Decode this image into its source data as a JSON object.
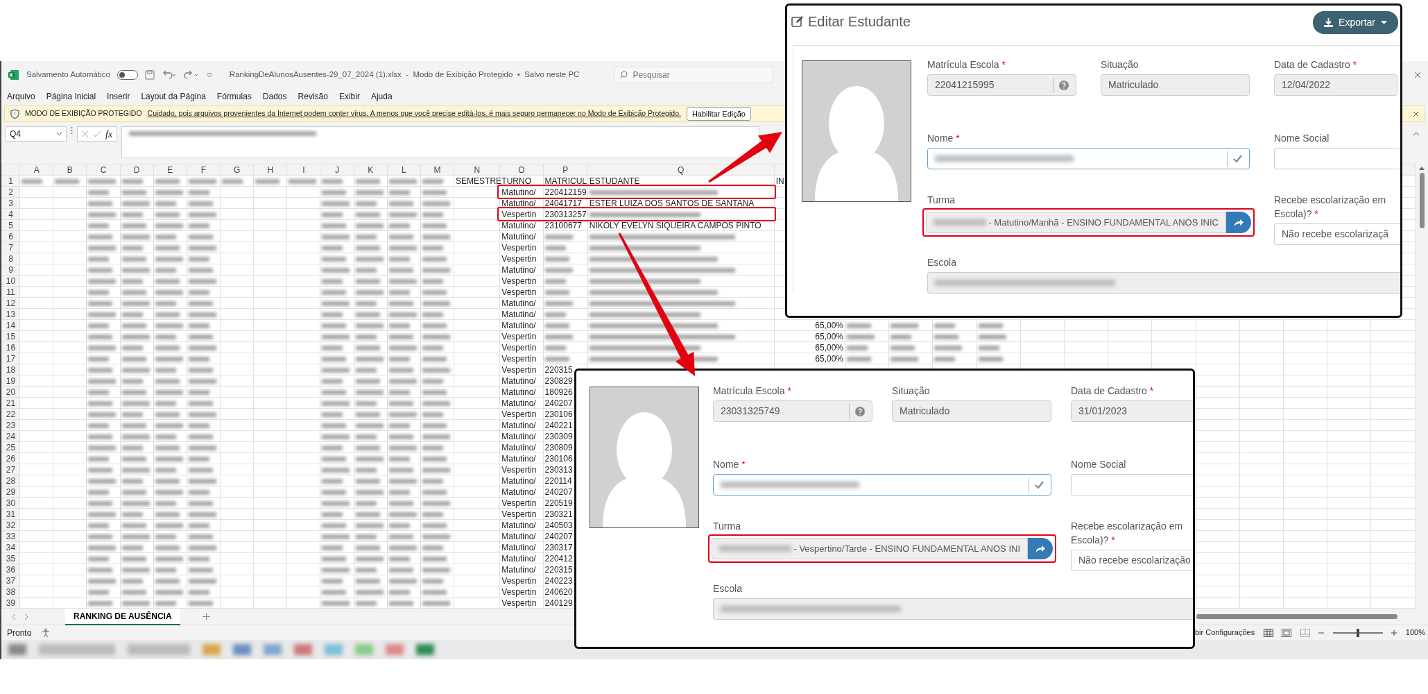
{
  "spreadsheet_window": {
    "autosave_label": "Salvamento Automático",
    "autosave_on": false,
    "file_title": "RankingDeAlunosAusentes-29_07_2024 (1).xlsx  -  Modo de Exibição Protegido  •  Salvo neste PC",
    "search": {
      "placeholder": "Pesquisar"
    },
    "menu": [
      "Arquivo",
      "Página Inicial",
      "Inserir",
      "Layout da Página",
      "Fórmulas",
      "Dados",
      "Revisão",
      "Exibir",
      "Ajuda"
    ],
    "protected_bar": {
      "title": "MODO DE EXIBIÇÃO PROTEGIDO",
      "message": "Cuidado, pois arquivos provenientes da Internet podem conter vírus. A menos que você precise editá-los, é mais seguro permanecer no Modo de  Exibição Protegido.",
      "button": "Habilitar Edição"
    },
    "name_box": "Q4",
    "function_label": "fx",
    "columns": [
      "A",
      "B",
      "C",
      "D",
      "E",
      "F",
      "G",
      "H",
      "I",
      "J",
      "K",
      "L",
      "M",
      "N",
      "O",
      "P",
      "Q"
    ],
    "rows": [
      {
        "number": "1",
        "cells": {
          "N": "SEMESTRE",
          "O": "TURNO",
          "P": "MATRICUL",
          "Q": "ESTUDANTE",
          "R": "IN"
        },
        "highlighted": false
      },
      {
        "number": "2",
        "cells": {
          "O": "Matutino/",
          "P": "220412159"
        },
        "highlighted": true
      },
      {
        "number": "3",
        "cells": {
          "O": "Matutino/",
          "P": "24041717",
          "Q": "ESTER LUIZA DOS SANTOS DE SANTANA"
        },
        "highlighted": false
      },
      {
        "number": "4",
        "cells": {
          "O": "Vespertin",
          "P": "230313257"
        },
        "highlighted": true
      },
      {
        "number": "5",
        "cells": {
          "O": "Matutino/",
          "P": "23100677",
          "Q": "NIKOLY EVELYN SIQUEIRA CAMPOS PINTO"
        },
        "highlighted": false
      },
      {
        "number": "6",
        "cells": {
          "O": "Matutino/"
        },
        "highlighted": false
      },
      {
        "number": "7",
        "cells": {
          "O": "Vespertin"
        },
        "highlighted": false
      },
      {
        "number": "8",
        "cells": {
          "O": "Vespertin"
        },
        "highlighted": false
      },
      {
        "number": "9",
        "cells": {
          "O": "Matutino/"
        },
        "highlighted": false
      },
      {
        "number": "10",
        "cells": {
          "O": "Vespertin"
        },
        "highlighted": false
      },
      {
        "number": "11",
        "cells": {
          "O": "Vespertin"
        },
        "highlighted": false
      },
      {
        "number": "12",
        "cells": {
          "O": "Matutino/"
        },
        "highlighted": false
      },
      {
        "number": "13",
        "cells": {
          "O": "Matutino/"
        },
        "highlighted": false
      },
      {
        "number": "14",
        "cells": {
          "O": "Matutino/",
          "R": "65,00%"
        },
        "highlighted": false
      },
      {
        "number": "15",
        "cells": {
          "O": "Vespertin",
          "R": "65,00%"
        },
        "highlighted": false
      },
      {
        "number": "16",
        "cells": {
          "O": "Vespertin",
          "R": "65,00%"
        },
        "highlighted": false
      },
      {
        "number": "17",
        "cells": {
          "O": "Vespertin",
          "R": "65,00%"
        },
        "highlighted": false
      },
      {
        "number": "18",
        "cells": {
          "O": "Vespertin",
          "P": "220315"
        },
        "highlighted": false
      },
      {
        "number": "19",
        "cells": {
          "O": "Matutino/",
          "P": "230829"
        },
        "highlighted": false
      },
      {
        "number": "20",
        "cells": {
          "O": "Matutino/",
          "P": "180926"
        },
        "highlighted": false
      },
      {
        "number": "21",
        "cells": {
          "O": "Matutino/",
          "P": "240207"
        },
        "highlighted": false
      },
      {
        "number": "22",
        "cells": {
          "O": "Vespertin",
          "P": "230106"
        },
        "highlighted": false
      },
      {
        "number": "23",
        "cells": {
          "O": "Matutino/",
          "P": "240221"
        },
        "highlighted": false
      },
      {
        "number": "24",
        "cells": {
          "O": "Matutino/",
          "P": "230309"
        },
        "highlighted": false
      },
      {
        "number": "25",
        "cells": {
          "O": "Matutino/",
          "P": "230809"
        },
        "highlighted": false
      },
      {
        "number": "26",
        "cells": {
          "O": "Matutino/",
          "P": "230106"
        },
        "highlighted": false
      },
      {
        "number": "27",
        "cells": {
          "O": "Vespertin",
          "P": "230313"
        },
        "highlighted": false
      },
      {
        "number": "28",
        "cells": {
          "O": "Matutino/",
          "P": "220114"
        },
        "highlighted": false
      },
      {
        "number": "29",
        "cells": {
          "O": "Matutino/",
          "P": "240207"
        },
        "highlighted": false
      },
      {
        "number": "30",
        "cells": {
          "O": "Vespertin",
          "P": "220519"
        },
        "highlighted": false
      },
      {
        "number": "31",
        "cells": {
          "O": "Vespertin",
          "P": "230321"
        },
        "highlighted": false
      },
      {
        "number": "32",
        "cells": {
          "O": "Matutino/",
          "P": "240503"
        },
        "highlighted": false
      },
      {
        "number": "33",
        "cells": {
          "O": "Matutino/",
          "P": "240207"
        },
        "highlighted": false
      },
      {
        "number": "34",
        "cells": {
          "O": "Matutino/",
          "P": "230317"
        },
        "highlighted": false
      },
      {
        "number": "35",
        "cells": {
          "O": "Matutino/",
          "P": "220412"
        },
        "highlighted": false
      },
      {
        "number": "36",
        "cells": {
          "O": "Matutino/",
          "P": "220315"
        },
        "highlighted": false
      },
      {
        "number": "37",
        "cells": {
          "O": "Vespertin",
          "P": "240223"
        },
        "highlighted": false
      },
      {
        "number": "38",
        "cells": {
          "O": "Vespertin",
          "P": "240620"
        },
        "highlighted": false
      },
      {
        "number": "39",
        "cells": {
          "O": "Vespertin",
          "P": "240129"
        },
        "highlighted": false
      }
    ],
    "sheet_tabs": [
      {
        "label": "RANKING DE AUSÊNCIA",
        "selected": true
      }
    ],
    "status": "Pronto",
    "view_settings_label": "bir Configurações",
    "zoom": {
      "level": 0.5,
      "reading": "100%"
    }
  },
  "top_panel": {
    "title": "Editar Estudante",
    "export_button": "Exportar",
    "fields": [
      {
        "label": "Matrícula Escola",
        "required_mark": "*",
        "kind": "help",
        "value": "22041215995",
        "disabled": true
      },
      {
        "label": "Situação",
        "kind": "plain",
        "value": "Matriculado",
        "disabled": true
      },
      {
        "label": "Data de Cadastro",
        "required_mark": "*",
        "kind": "plain",
        "value": "12/04/2022",
        "disabled": true
      },
      {
        "label": "Nome",
        "required_mark": "*",
        "kind": "check",
        "disabled": false
      },
      {
        "label": "Nome Social",
        "kind": "plain",
        "disabled": false
      },
      {
        "label": "Turma",
        "kind": "link",
        "value": "- Matutino/Manhã - ENSINO FUNDAMENTAL ANOS INIC",
        "disabled": true,
        "highlighted": true
      },
      {
        "label_lines": [
          "Recebe escolarização em",
          "Escola)?"
        ],
        "required_mark": "*",
        "kind": "select",
        "value": "Não recebe escolarizaçã",
        "disabled": false
      },
      {
        "label": "Escola",
        "kind": "redacted",
        "disabled": true
      }
    ]
  },
  "bottom_panel": {
    "fields": [
      {
        "label": "Matrícula Escola",
        "required_mark": "*",
        "kind": "help",
        "value": "23031325749",
        "disabled": true
      },
      {
        "label": "Situação",
        "kind": "plain",
        "value": "Matriculado",
        "disabled": true
      },
      {
        "label": "Data de Cadastro",
        "required_mark": "*",
        "kind": "plain",
        "value": "31/01/2023",
        "disabled": true
      },
      {
        "label": "Nome",
        "required_mark": "*",
        "kind": "check",
        "disabled": false
      },
      {
        "label": "Nome Social",
        "kind": "plain",
        "disabled": false
      },
      {
        "label": "Turma",
        "kind": "link",
        "value": "- Vespertino/Tarde - ENSINO FUNDAMENTAL ANOS INI",
        "disabled": true,
        "highlighted": true
      },
      {
        "label_lines": [
          "Recebe escolarização em",
          "Escola)?"
        ],
        "required_mark": "*",
        "kind": "select",
        "value": "Não recebe escolarização",
        "disabled": false
      },
      {
        "label": "Escola",
        "kind": "redacted",
        "disabled": true
      }
    ]
  }
}
